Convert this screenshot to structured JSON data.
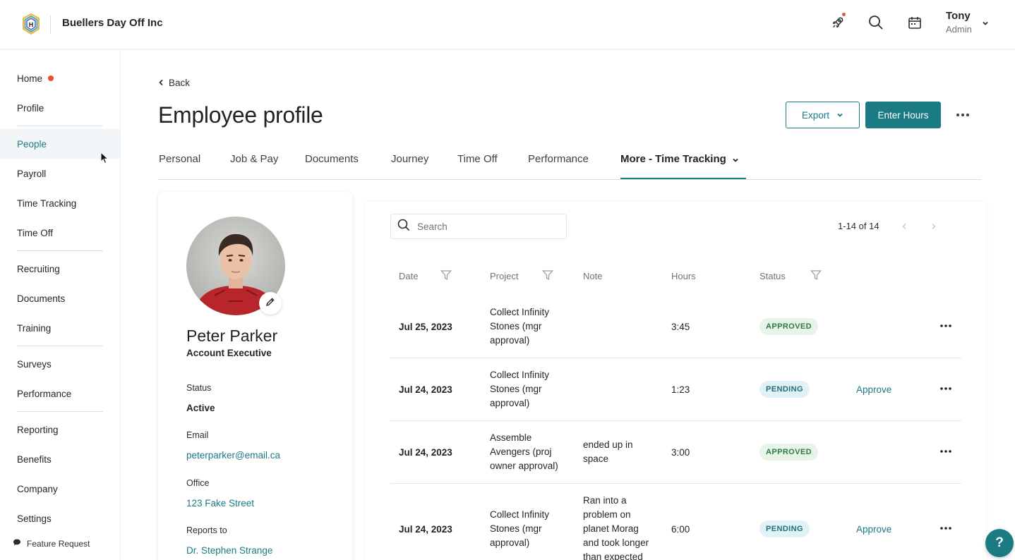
{
  "header": {
    "company": "Buellers Day Off Inc",
    "logo_letter": "H",
    "user_name": "Tony",
    "user_role": "Admin",
    "notification_color": "#e5532e"
  },
  "sidebar": {
    "items": [
      {
        "label": "Home"
      },
      {
        "label": "Profile"
      },
      {
        "label": "People"
      },
      {
        "label": "Payroll"
      },
      {
        "label": "Time Tracking"
      },
      {
        "label": "Time Off"
      },
      {
        "label": "Recruiting"
      },
      {
        "label": "Documents"
      },
      {
        "label": "Training"
      },
      {
        "label": "Surveys"
      },
      {
        "label": "Performance"
      },
      {
        "label": "Reporting"
      },
      {
        "label": "Benefits"
      },
      {
        "label": "Company"
      },
      {
        "label": "Settings"
      }
    ],
    "active": "People",
    "feature_request": "Feature Request"
  },
  "page": {
    "back": "Back",
    "title": "Employee profile",
    "export_label": "Export",
    "enter_hours_label": "Enter Hours"
  },
  "tabs": [
    {
      "label": "Personal"
    },
    {
      "label": "Job & Pay"
    },
    {
      "label": "Documents"
    },
    {
      "label": "Journey"
    },
    {
      "label": "Time Off"
    },
    {
      "label": "Performance"
    },
    {
      "label": "More - Time Tracking"
    }
  ],
  "profile": {
    "name": "Peter Parker",
    "title": "Account Executive",
    "status_label": "Status",
    "status_value": "Active",
    "email_label": "Email",
    "email_value": "peterparker@email.ca",
    "office_label": "Office",
    "office_value": "123 Fake Street",
    "reports_label": "Reports to",
    "reports_value": "Dr. Stephen Strange"
  },
  "time_tracking": {
    "search_placeholder": "Search",
    "pager": "1-14 of 14",
    "columns": {
      "date": "Date",
      "project": "Project",
      "note": "Note",
      "hours": "Hours",
      "status": "Status"
    },
    "rows": [
      {
        "date": "Jul 25, 2023",
        "project": "Collect Infinity Stones (mgr approval)",
        "note": "",
        "hours": "3:45",
        "status": "APPROVED",
        "action": ""
      },
      {
        "date": "Jul 24, 2023",
        "project": "Collect Infinity Stones (mgr approval)",
        "note": "",
        "hours": "1:23",
        "status": "PENDING",
        "action": "Approve"
      },
      {
        "date": "Jul 24, 2023",
        "project": "Assemble Avengers (proj owner approval)",
        "note": "ended up in space",
        "hours": "3:00",
        "status": "APPROVED",
        "action": ""
      },
      {
        "date": "Jul 24, 2023",
        "project": "Collect Infinity Stones (mgr approval)",
        "note": "Ran into a problem on planet Morag and took longer than expected",
        "hours": "6:00",
        "status": "PENDING",
        "action": "Approve"
      }
    ]
  },
  "help_label": "?",
  "colors": {
    "accent": "#1a7b84",
    "approved_bg": "#e8f3ea",
    "approved_text": "#2f7b3d",
    "pending_bg": "#e1f2f6",
    "pending_text": "#1f6f7a"
  }
}
